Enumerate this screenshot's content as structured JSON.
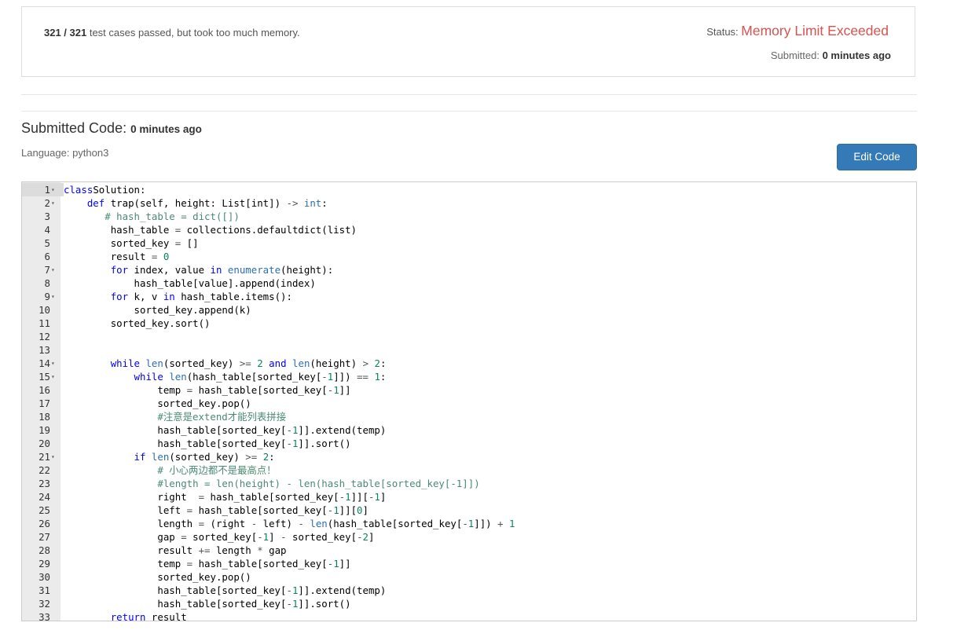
{
  "result": {
    "passed": "321 / 321",
    "summary_rest": " test cases passed, but took too much memory.",
    "status_label": "Status: ",
    "status_value": "Memory Limit Exceeded",
    "status_color": "#d9534f",
    "submitted_label": "Submitted: ",
    "submitted_value": "0 minutes ago"
  },
  "code_section": {
    "title": "Submitted Code:",
    "title_time": "0 minutes ago",
    "language_label": "Language: python3",
    "edit_button": "Edit Code",
    "accent": "#337ab7"
  },
  "editor": {
    "lines": [
      {
        "n": "1",
        "fold": true,
        "active": true,
        "indent": 0,
        "tokens": [
          [
            "kw",
            "class"
          ],
          [
            "",
            "Solution:"
          ]
        ]
      },
      {
        "n": "2",
        "fold": true,
        "indent": 4,
        "tokens": [
          [
            "kw",
            "def"
          ],
          [
            "",
            " trap(self, height: List[int]) "
          ],
          [
            "op",
            "->"
          ],
          [
            "",
            " "
          ],
          [
            "bi",
            "int"
          ],
          [
            "",
            ":"
          ]
        ]
      },
      {
        "n": "3",
        "indent": 7,
        "tokens": [
          [
            "cm",
            "# hash_table = dict([])"
          ]
        ]
      },
      {
        "n": "4",
        "indent": 8,
        "tokens": [
          [
            "",
            "hash_table "
          ],
          [
            "op",
            "="
          ],
          [
            "",
            " collections.defaultdict(list)"
          ]
        ]
      },
      {
        "n": "5",
        "indent": 8,
        "tokens": [
          [
            "",
            "sorted_key "
          ],
          [
            "op",
            "="
          ],
          [
            "",
            " []"
          ]
        ]
      },
      {
        "n": "6",
        "indent": 8,
        "tokens": [
          [
            "",
            "result "
          ],
          [
            "op",
            "="
          ],
          [
            "",
            " "
          ],
          [
            "num",
            "0"
          ]
        ]
      },
      {
        "n": "7",
        "fold": true,
        "indent": 8,
        "tokens": [
          [
            "kw",
            "for"
          ],
          [
            "",
            " index, value "
          ],
          [
            "kw",
            "in"
          ],
          [
            "",
            " "
          ],
          [
            "bi",
            "enumerate"
          ],
          [
            "",
            "(height):"
          ]
        ]
      },
      {
        "n": "8",
        "indent": 12,
        "tokens": [
          [
            "",
            "hash_table[value].append(index)"
          ]
        ]
      },
      {
        "n": "9",
        "fold": true,
        "indent": 8,
        "tokens": [
          [
            "kw",
            "for"
          ],
          [
            "",
            " k, v "
          ],
          [
            "kw",
            "in"
          ],
          [
            "",
            " hash_table.items():"
          ]
        ]
      },
      {
        "n": "10",
        "indent": 12,
        "tokens": [
          [
            "",
            "sorted_key.append(k)"
          ]
        ]
      },
      {
        "n": "11",
        "indent": 8,
        "tokens": [
          [
            "",
            "sorted_key.sort()"
          ]
        ]
      },
      {
        "n": "12",
        "indent": 0,
        "tokens": []
      },
      {
        "n": "13",
        "indent": 0,
        "tokens": []
      },
      {
        "n": "14",
        "fold": true,
        "indent": 8,
        "tokens": [
          [
            "kw",
            "while"
          ],
          [
            "",
            " "
          ],
          [
            "bi",
            "len"
          ],
          [
            "",
            "(sorted_key) "
          ],
          [
            "op",
            ">="
          ],
          [
            "",
            " "
          ],
          [
            "num",
            "2"
          ],
          [
            "",
            " "
          ],
          [
            "kw",
            "and"
          ],
          [
            "",
            " "
          ],
          [
            "bi",
            "len"
          ],
          [
            "",
            "(height) "
          ],
          [
            "op",
            ">"
          ],
          [
            "",
            " "
          ],
          [
            "num",
            "2"
          ],
          [
            "",
            ":"
          ]
        ]
      },
      {
        "n": "15",
        "fold": true,
        "indent": 12,
        "tokens": [
          [
            "kw",
            "while"
          ],
          [
            "",
            " "
          ],
          [
            "bi",
            "len"
          ],
          [
            "",
            "(hash_table[sorted_key["
          ],
          [
            "op",
            "-"
          ],
          [
            "num",
            "1"
          ],
          [
            "",
            "]]) "
          ],
          [
            "op",
            "=="
          ],
          [
            "",
            " "
          ],
          [
            "num",
            "1"
          ],
          [
            "",
            ":"
          ]
        ]
      },
      {
        "n": "16",
        "indent": 16,
        "tokens": [
          [
            "",
            "temp "
          ],
          [
            "op",
            "="
          ],
          [
            "",
            " hash_table[sorted_key["
          ],
          [
            "op",
            "-"
          ],
          [
            "num",
            "1"
          ],
          [
            "",
            "]]"
          ]
        ]
      },
      {
        "n": "17",
        "indent": 16,
        "tokens": [
          [
            "",
            "sorted_key.pop()"
          ]
        ]
      },
      {
        "n": "18",
        "indent": 16,
        "tokens": [
          [
            "cm",
            "#注意是extend才能列表拼接"
          ]
        ]
      },
      {
        "n": "19",
        "indent": 16,
        "tokens": [
          [
            "",
            "hash_table[sorted_key["
          ],
          [
            "op",
            "-"
          ],
          [
            "num",
            "1"
          ],
          [
            "",
            "]].extend(temp)"
          ]
        ]
      },
      {
        "n": "20",
        "indent": 16,
        "tokens": [
          [
            "",
            "hash_table[sorted_key["
          ],
          [
            "op",
            "-"
          ],
          [
            "num",
            "1"
          ],
          [
            "",
            "]].sort()"
          ]
        ]
      },
      {
        "n": "21",
        "fold": true,
        "indent": 12,
        "tokens": [
          [
            "kw",
            "if"
          ],
          [
            "",
            " "
          ],
          [
            "bi",
            "len"
          ],
          [
            "",
            "(sorted_key) "
          ],
          [
            "op",
            ">="
          ],
          [
            "",
            " "
          ],
          [
            "num",
            "2"
          ],
          [
            "",
            ":"
          ]
        ]
      },
      {
        "n": "22",
        "indent": 16,
        "tokens": [
          [
            "cm",
            "# 小心两边都不是最高点！"
          ]
        ]
      },
      {
        "n": "23",
        "indent": 16,
        "tokens": [
          [
            "cm",
            "#length = len(height) - len(hash_table[sorted_key[-1]])"
          ]
        ]
      },
      {
        "n": "24",
        "indent": 16,
        "tokens": [
          [
            "",
            "right  "
          ],
          [
            "op",
            "="
          ],
          [
            "",
            " hash_table[sorted_key["
          ],
          [
            "op",
            "-"
          ],
          [
            "num",
            "1"
          ],
          [
            "",
            "]]["
          ],
          [
            "op",
            "-"
          ],
          [
            "num",
            "1"
          ],
          [
            "",
            "]"
          ]
        ]
      },
      {
        "n": "25",
        "indent": 16,
        "tokens": [
          [
            "",
            "left "
          ],
          [
            "op",
            "="
          ],
          [
            "",
            " hash_table[sorted_key["
          ],
          [
            "op",
            "-"
          ],
          [
            "num",
            "1"
          ],
          [
            "",
            "]]["
          ],
          [
            "num",
            "0"
          ],
          [
            "",
            "]"
          ]
        ]
      },
      {
        "n": "26",
        "indent": 16,
        "tokens": [
          [
            "",
            "length "
          ],
          [
            "op",
            "="
          ],
          [
            "",
            " (right "
          ],
          [
            "op",
            "-"
          ],
          [
            "",
            " left) "
          ],
          [
            "op",
            "-"
          ],
          [
            "",
            " "
          ],
          [
            "bi",
            "len"
          ],
          [
            "",
            "(hash_table[sorted_key["
          ],
          [
            "op",
            "-"
          ],
          [
            "num",
            "1"
          ],
          [
            "",
            "]]) "
          ],
          [
            "op",
            "+"
          ],
          [
            "",
            " "
          ],
          [
            "num",
            "1"
          ]
        ]
      },
      {
        "n": "27",
        "indent": 16,
        "tokens": [
          [
            "",
            "gap "
          ],
          [
            "op",
            "="
          ],
          [
            "",
            " sorted_key["
          ],
          [
            "op",
            "-"
          ],
          [
            "num",
            "1"
          ],
          [
            "",
            "] "
          ],
          [
            "op",
            "-"
          ],
          [
            "",
            " sorted_key["
          ],
          [
            "op",
            "-"
          ],
          [
            "num",
            "2"
          ],
          [
            "",
            "]"
          ]
        ]
      },
      {
        "n": "28",
        "indent": 16,
        "tokens": [
          [
            "",
            "result "
          ],
          [
            "op",
            "+="
          ],
          [
            "",
            " length "
          ],
          [
            "op",
            "*"
          ],
          [
            "",
            " gap"
          ]
        ]
      },
      {
        "n": "29",
        "indent": 16,
        "tokens": [
          [
            "",
            "temp "
          ],
          [
            "op",
            "="
          ],
          [
            "",
            " hash_table[sorted_key["
          ],
          [
            "op",
            "-"
          ],
          [
            "num",
            "1"
          ],
          [
            "",
            "]]"
          ]
        ]
      },
      {
        "n": "30",
        "indent": 16,
        "tokens": [
          [
            "",
            "sorted_key.pop()"
          ]
        ]
      },
      {
        "n": "31",
        "indent": 16,
        "tokens": [
          [
            "",
            "hash_table[sorted_key["
          ],
          [
            "op",
            "-"
          ],
          [
            "num",
            "1"
          ],
          [
            "",
            "]].extend(temp)"
          ]
        ]
      },
      {
        "n": "32",
        "indent": 16,
        "tokens": [
          [
            "",
            "hash_table[sorted_key["
          ],
          [
            "op",
            "-"
          ],
          [
            "num",
            "1"
          ],
          [
            "",
            "]].sort()"
          ]
        ]
      },
      {
        "n": "33",
        "indent": 8,
        "tokens": [
          [
            "kw",
            "return"
          ],
          [
            "",
            " result"
          ]
        ]
      }
    ]
  }
}
